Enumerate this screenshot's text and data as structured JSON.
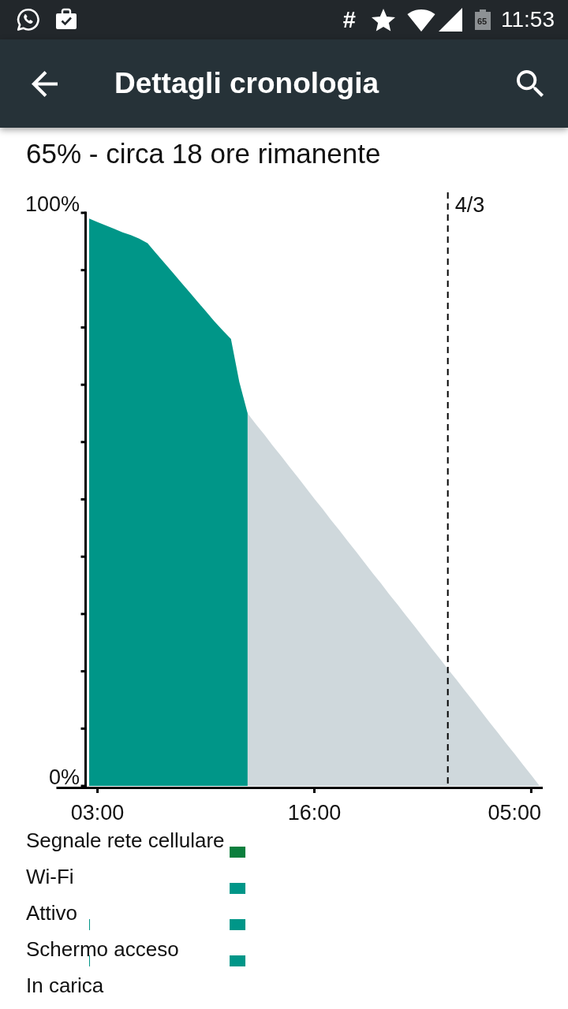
{
  "status_bar": {
    "network_symbol": "#",
    "battery_text": "65",
    "time": "11:53"
  },
  "app_bar": {
    "title": "Dettagli cronologia"
  },
  "summary": "65% - circa 18 ore rimanente",
  "history": {
    "chart_data": {
      "type": "area",
      "categories": [
        null,
        "03:00",
        null,
        null,
        null,
        null,
        null,
        null,
        null,
        null,
        null,
        null,
        null,
        null,
        null,
        null,
        null,
        null,
        null,
        null,
        null,
        null,
        null,
        null,
        null,
        null,
        null,
        "16:00",
        null,
        null,
        null,
        null,
        null,
        null,
        null,
        null,
        null,
        null,
        null,
        null,
        null,
        null,
        null,
        null,
        null,
        null,
        null,
        null,
        null,
        null,
        null,
        null,
        null,
        "05:00",
        null
      ],
      "series": [
        {
          "color": "#009688",
          "values": [
            99,
            98.4,
            97.8,
            97.2,
            96.6,
            96.1,
            95.5,
            94.7,
            93,
            91.3,
            89.6,
            87.9,
            86.2,
            84.5,
            82.8,
            81.1,
            79.5,
            78,
            70.5,
            65,
            null,
            null,
            null,
            null,
            null,
            null,
            null,
            null,
            null,
            null,
            null,
            null,
            null,
            null,
            null,
            null,
            null,
            null,
            null,
            null,
            null,
            null,
            null,
            null,
            null,
            null,
            null,
            null,
            null,
            null,
            null,
            null,
            null,
            null,
            null
          ]
        },
        {
          "color": "#cfd8dc",
          "values": [
            null,
            null,
            null,
            null,
            null,
            null,
            null,
            null,
            null,
            null,
            null,
            null,
            null,
            null,
            null,
            null,
            null,
            null,
            null,
            65,
            63.1,
            61.3,
            59.4,
            57.6,
            55.7,
            53.9,
            52,
            50.1,
            48.3,
            46.4,
            44.6,
            42.7,
            40.9,
            39,
            37.1,
            35.3,
            33.4,
            31.6,
            29.7,
            27.9,
            26,
            24.1,
            22.3,
            20.4,
            18.6,
            16.7,
            14.9,
            13,
            11.1,
            9.3,
            7.4,
            5.6,
            3.7,
            1.9,
            0
          ]
        }
      ],
      "ylim": [
        0,
        100
      ],
      "yticks": [
        {
          "value": 0,
          "label": "0%"
        },
        {
          "value": 100,
          "label": "100%"
        }
      ],
      "annotations": [
        "4/3"
      ]
    },
    "rows": [
      {
        "label": "Segnale rete cellulare",
        "color": "#0b7f3d"
      },
      {
        "label": "Wi-Fi",
        "color": "#009688"
      },
      {
        "label": "Attivo",
        "color": "#009688"
      },
      {
        "label": "Schermo acceso",
        "color": "#009688"
      },
      {
        "label": "In carica"
      }
    ]
  }
}
